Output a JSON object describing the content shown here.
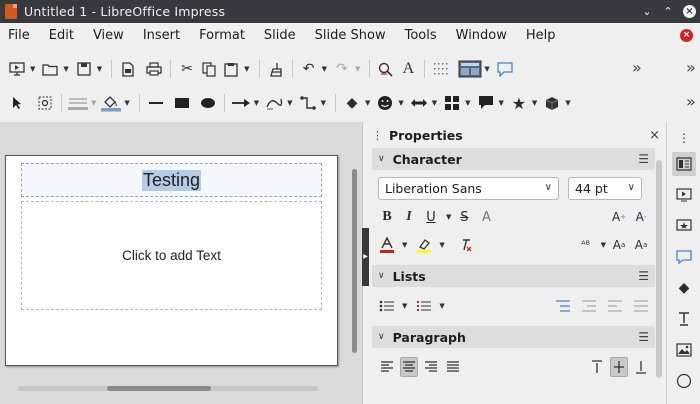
{
  "window": {
    "title": "Untitled 1 - LibreOffice Impress",
    "close_glyph": "×"
  },
  "menu": [
    "File",
    "Edit",
    "View",
    "Insert",
    "Format",
    "Slide",
    "Slide Show",
    "Tools",
    "Window",
    "Help"
  ],
  "icons": {
    "toolbar1": [
      "slideshow-icon",
      "open-icon",
      "save-icon",
      "export-pdf-icon",
      "print-icon",
      "cut-icon",
      "copy-icon",
      "paste-icon",
      "clone-formatting-icon",
      "undo-icon",
      "redo-icon",
      "find-replace-icon",
      "spelling-icon",
      "grid-icon",
      "display-views-icon",
      "comment-icon"
    ],
    "toolbar2": [
      "select-icon",
      "zoom-pan-icon",
      "line-color-icon",
      "fill-color-icon",
      "line-icon",
      "rectangle-icon",
      "ellipse-icon",
      "arrow-icon",
      "curve-icon",
      "connector-icon",
      "basic-shapes-icon",
      "symbol-shapes-icon",
      "block-arrows-icon",
      "flowchart-icon",
      "callouts-icon",
      "stars-icon",
      "3d-objects-icon"
    ]
  },
  "slide": {
    "title_text": "Testing",
    "content_placeholder": "Click to add Text"
  },
  "properties": {
    "header": "Properties",
    "sections": {
      "character": "Character",
      "lists": "Lists",
      "paragraph": "Paragraph"
    },
    "font_name": "Liberation Sans",
    "font_size": "44 pt"
  },
  "colors": {
    "accent": "#4a7fc1",
    "font_color": "#c9211e",
    "highlight": "#ffff00",
    "titlebar": "#363a3f"
  }
}
